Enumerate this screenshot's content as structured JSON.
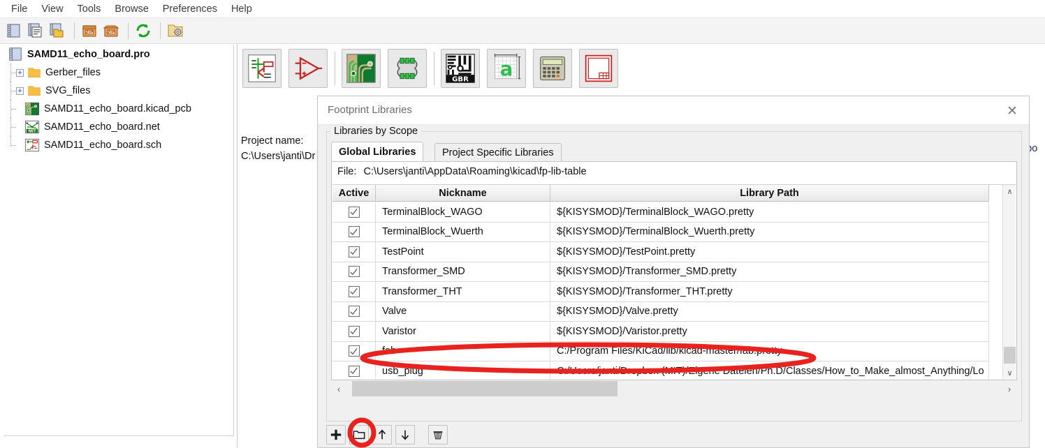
{
  "menubar": {
    "items": [
      {
        "label": "File"
      },
      {
        "label": "View"
      },
      {
        "label": "Tools"
      },
      {
        "label": "Browse"
      },
      {
        "label": "Preferences"
      },
      {
        "label": "Help"
      }
    ]
  },
  "main_toolbar": {
    "buttons": [
      {
        "name": "new-project-icon",
        "tooltip": "New Project"
      },
      {
        "name": "new-project-from-template-icon",
        "tooltip": "New Project from Template"
      },
      {
        "name": "open-project-icon",
        "tooltip": "Open Project"
      },
      {
        "name": "archive-project-zip-icon",
        "tooltip": "Archive Project"
      },
      {
        "name": "unarchive-project-zip-icon",
        "tooltip": "Unarchive Project"
      },
      {
        "name": "refresh-icon",
        "tooltip": "Refresh Project Tree"
      },
      {
        "name": "open-project-directory-icon",
        "tooltip": "Open Project Directory"
      }
    ]
  },
  "project_tree": {
    "root": {
      "label": "SAMD11_echo_board.pro",
      "icon": "project-icon"
    },
    "items": [
      {
        "label": "Gerber_files",
        "icon": "folder-icon",
        "expandable": true,
        "expander": "+"
      },
      {
        "label": "SVG_files",
        "icon": "folder-icon",
        "expandable": true,
        "expander": "+"
      },
      {
        "label": "SAMD11_echo_board.kicad_pcb",
        "icon": "pcb-file-icon",
        "expandable": false
      },
      {
        "label": "SAMD11_echo_board.net",
        "icon": "netlist-file-icon",
        "expandable": false
      },
      {
        "label": "SAMD11_echo_board.sch",
        "icon": "schematic-file-icon",
        "expandable": false
      }
    ]
  },
  "project_toolbar": {
    "buttons": [
      {
        "name": "eeschema-icon",
        "tooltip": "Schematic Layout Editor"
      },
      {
        "name": "symbol-editor-icon",
        "tooltip": "Symbol Editor"
      },
      {
        "name": "pcbnew-icon",
        "tooltip": "PCB Layout Editor"
      },
      {
        "name": "footprint-editor-icon",
        "tooltip": "Footprint Editor"
      },
      {
        "name": "gerbview-icon",
        "tooltip": "GerbView"
      },
      {
        "name": "bitmap2component-icon",
        "tooltip": "Bitmap to Component Converter"
      },
      {
        "name": "pcb-calculator-icon",
        "tooltip": "PCB Calculator"
      },
      {
        "name": "pl-editor-icon",
        "tooltip": "Page Layout Editor"
      }
    ]
  },
  "project_info": {
    "label": "Project name:",
    "path": "C:\\Users\\janti\\Dr"
  },
  "background_text": "ho_bo",
  "dialog": {
    "title": "Footprint Libraries",
    "close_label": "✕",
    "group_label": "Libraries by Scope",
    "tabs": [
      {
        "label": "Global Libraries",
        "active": true
      },
      {
        "label": "Project Specific Libraries",
        "active": false
      }
    ],
    "file_label": "File:",
    "file_path": "C:\\Users\\janti\\AppData\\Roaming\\kicad\\fp-lib-table",
    "columns": [
      "Active",
      "Nickname",
      "Library Path"
    ],
    "rows": [
      {
        "active": true,
        "nickname": "TerminalBlock_WAGO",
        "path": "${KISYSMOD}/TerminalBlock_WAGO.pretty",
        "highlighted": false
      },
      {
        "active": true,
        "nickname": "TerminalBlock_Wuerth",
        "path": "${KISYSMOD}/TerminalBlock_Wuerth.pretty",
        "highlighted": false
      },
      {
        "active": true,
        "nickname": "TestPoint",
        "path": "${KISYSMOD}/TestPoint.pretty",
        "highlighted": false
      },
      {
        "active": true,
        "nickname": "Transformer_SMD",
        "path": "${KISYSMOD}/Transformer_SMD.pretty",
        "highlighted": false
      },
      {
        "active": true,
        "nickname": "Transformer_THT",
        "path": "${KISYSMOD}/Transformer_THT.pretty",
        "highlighted": false
      },
      {
        "active": true,
        "nickname": "Valve",
        "path": "${KISYSMOD}/Valve.pretty",
        "highlighted": false
      },
      {
        "active": true,
        "nickname": "Varistor",
        "path": "${KISYSMOD}/Varistor.pretty",
        "highlighted": false
      },
      {
        "active": true,
        "nickname": "fab",
        "path": "C:/Program Files/KiCad/lib/kicad-master/fab.pretty",
        "highlighted": true
      },
      {
        "active": true,
        "nickname": "usb_plug",
        "path": "C:/Users/janti/Dropbox (MIT)/Eigene Dateien/Ph.D/Classes/How_to_Make_almost_Anything/Lo",
        "highlighted": false
      }
    ],
    "scrollbars": {
      "vertical_up": "∧",
      "vertical_down": "∨",
      "horizontal_left": "‹",
      "horizontal_right": "›"
    },
    "action_buttons": [
      {
        "name": "add-library-button",
        "glyph": "+",
        "tooltip": "Add Library"
      },
      {
        "name": "browse-library-button",
        "glyph": "folder",
        "tooltip": "Browse Libraries",
        "highlighted": true
      },
      {
        "name": "move-up-button",
        "glyph": "↑",
        "tooltip": "Move Up"
      },
      {
        "name": "move-down-button",
        "glyph": "↓",
        "tooltip": "Move Down"
      },
      {
        "name": "delete-library-button",
        "glyph": "trash",
        "tooltip": "Delete Library"
      }
    ]
  },
  "annotations": {
    "color": "#e8231f",
    "shapes": [
      {
        "name": "fab-row-highlight-oval",
        "type": "ellipse"
      },
      {
        "name": "browse-button-highlight-oval",
        "type": "ellipse"
      }
    ]
  }
}
